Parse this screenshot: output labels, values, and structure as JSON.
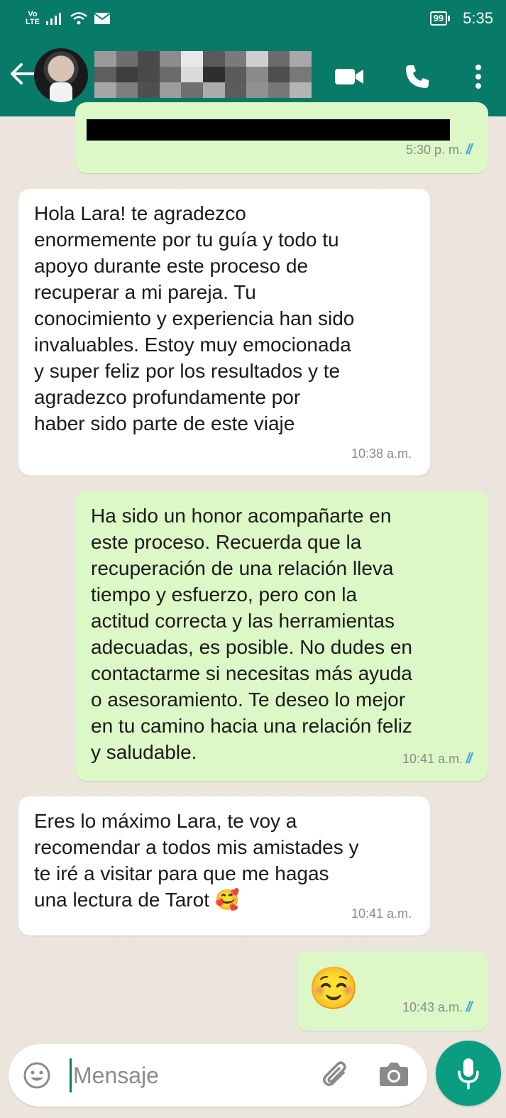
{
  "status_bar": {
    "network_top": "Vo",
    "network_bottom": "LTE",
    "battery": "99",
    "time": "5:35"
  },
  "header": {
    "contact_name_blurred": true,
    "back_icon": "back-arrow-icon",
    "video_icon": "video-camera-icon",
    "call_icon": "phone-icon",
    "menu_icon": "more-vertical-icon"
  },
  "messages": [
    {
      "direction": "out",
      "text": "",
      "redacted": true,
      "time": "5:30 p. m.",
      "read": true
    },
    {
      "direction": "in",
      "text": "Hola Lara! te agradezco\nenormemente por tu guía y todo tu\napoyo durante este proceso de\nrecuperar a mi pareja. Tu\nconocimiento y experiencia han sido\ninvaluables. Estoy muy emocionada\ny super feliz por los resultados y te\nagradezco profundamente por\nhaber sido parte de este viaje",
      "time": "10:38 a.m."
    },
    {
      "direction": "out",
      "text": "Ha sido un honor acompañarte en\neste proceso. Recuerda que la\nrecuperación de una relación lleva\ntiempo y esfuerzo, pero con la\nactitud correcta y las herramientas\nadecuadas, es posible. No dudes en\ncontactarme si necesitas más ayuda\no asesoramiento. Te deseo lo mejor\nen tu camino hacia una relación feliz\ny saludable.",
      "time": "10:41 a.m.",
      "read": true
    },
    {
      "direction": "in",
      "text": "Eres lo máximo Lara, te voy a\nrecomendar a todos mis amistades y\nte iré a visitar para que me hagas\nuna lectura de Tarot 🥰",
      "time": "10:41 a.m."
    },
    {
      "direction": "out",
      "text": "☺️",
      "time": "10:43 a.m.",
      "read": true
    }
  ],
  "input": {
    "placeholder": "Mensaje"
  },
  "colors": {
    "header": "#077a68",
    "chat_bg": "#ece5dd",
    "out_bubble": "#dcf8c6",
    "in_bubble": "#ffffff",
    "read_ticks": "#4fa3e0",
    "mic_button": "#0b9d82"
  }
}
